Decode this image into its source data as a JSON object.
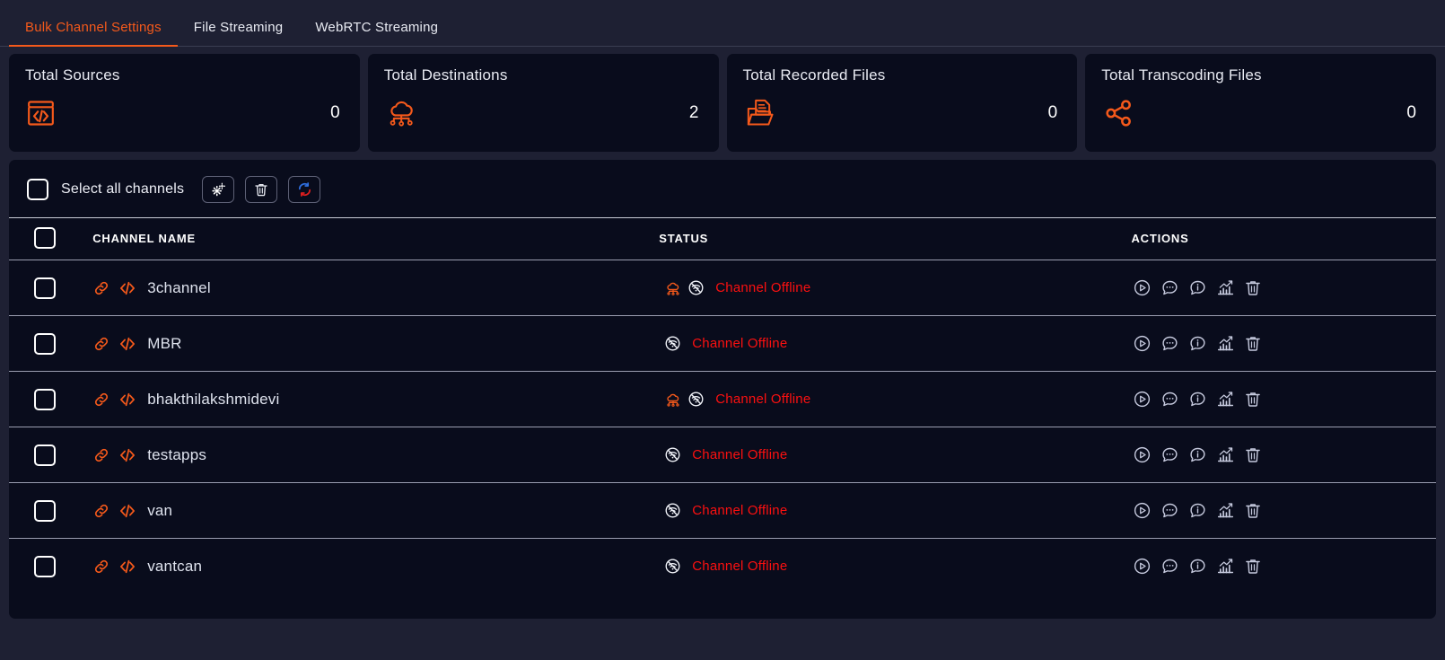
{
  "tabs": [
    {
      "label": "Bulk Channel Settings",
      "active": true
    },
    {
      "label": "File Streaming",
      "active": false
    },
    {
      "label": "WebRTC Streaming",
      "active": false
    }
  ],
  "cards": [
    {
      "title": "Total Sources",
      "value": "0",
      "icon": "code-window-icon"
    },
    {
      "title": "Total Destinations",
      "value": "2",
      "icon": "cloud-network-icon"
    },
    {
      "title": "Total Recorded Files",
      "value": "0",
      "icon": "folder-document-icon"
    },
    {
      "title": "Total Transcoding Files",
      "value": "0",
      "icon": "share-nodes-icon"
    }
  ],
  "toolbar": {
    "select_all_label": "Select all channels",
    "buttons": [
      {
        "name": "bulk-settings-button",
        "icon": "gears-icon"
      },
      {
        "name": "bulk-delete-button",
        "icon": "trash-icon"
      },
      {
        "name": "refresh-button",
        "icon": "refresh-icon"
      }
    ]
  },
  "table": {
    "headers": {
      "checkbox": "",
      "name": "CHANNEL NAME",
      "status": "STATUS",
      "actions": "ACTIONS"
    },
    "rows": [
      {
        "name": "3channel",
        "status": "Channel Offline",
        "has_cloud": true
      },
      {
        "name": "MBR",
        "status": "Channel Offline",
        "has_cloud": false
      },
      {
        "name": "bhakthilakshmidevi",
        "status": "Channel Offline",
        "has_cloud": true
      },
      {
        "name": "testapps",
        "status": "Channel Offline",
        "has_cloud": false
      },
      {
        "name": "van",
        "status": "Channel Offline",
        "has_cloud": false
      },
      {
        "name": "vantcan",
        "status": "Channel Offline",
        "has_cloud": false
      }
    ],
    "row_icons": {
      "link": "link-icon",
      "code": "code-icon",
      "cloud": "cloud-network-icon",
      "offline": "wifi-off-icon"
    },
    "actions": [
      {
        "name": "play-button",
        "icon": "play-circle-icon"
      },
      {
        "name": "chat-button",
        "icon": "chat-bubble-icon"
      },
      {
        "name": "info-button",
        "icon": "info-bubble-icon"
      },
      {
        "name": "analytics-button",
        "icon": "bar-chart-icon"
      },
      {
        "name": "delete-button",
        "icon": "trash-icon"
      }
    ]
  },
  "colors": {
    "accent": "#f4591b",
    "offline": "#fb1010",
    "page_bg": "#1e2033",
    "panel_bg": "#090c1c",
    "text": "#e8eaf2"
  }
}
